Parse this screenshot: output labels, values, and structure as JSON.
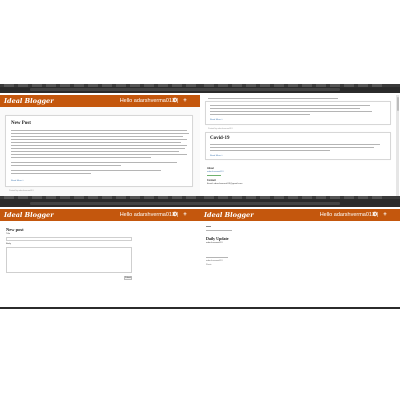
{
  "app": {
    "brand": "Ideal Blogger",
    "greeting": "Hello adarshverma013 |",
    "greeting_right": "Hello adarshverma013 |",
    "greeting_bl": "Hello adarshverma013 |",
    "greeting_br": "Hello adarshverma013 |",
    "add_icon": "plus-icon",
    "settings_icon": "gear-icon",
    "accent": "#c4570d"
  },
  "pane_tl": {
    "post_title": "New Post",
    "meta": "Posted by adarshverma013",
    "read_more": "Read More »"
  },
  "pane_tr": {
    "post_title": "Covid-19",
    "meta": "Posted by adarshverma013",
    "read_more": "Read More »",
    "about_label": "About",
    "about_link": "adarshverma013",
    "contact_label": "Contact",
    "contact_text": "Email: adarshverma013@gmail.com"
  },
  "pane_bl": {
    "form_title": "New post",
    "title_label": "Title",
    "body_label": "Body",
    "submit_label": "Submit"
  },
  "pane_br": {
    "heading": "Daily Update",
    "sub": "adarshverma013",
    "footer_1": "adarshverma013",
    "footer_2": "Posts"
  }
}
